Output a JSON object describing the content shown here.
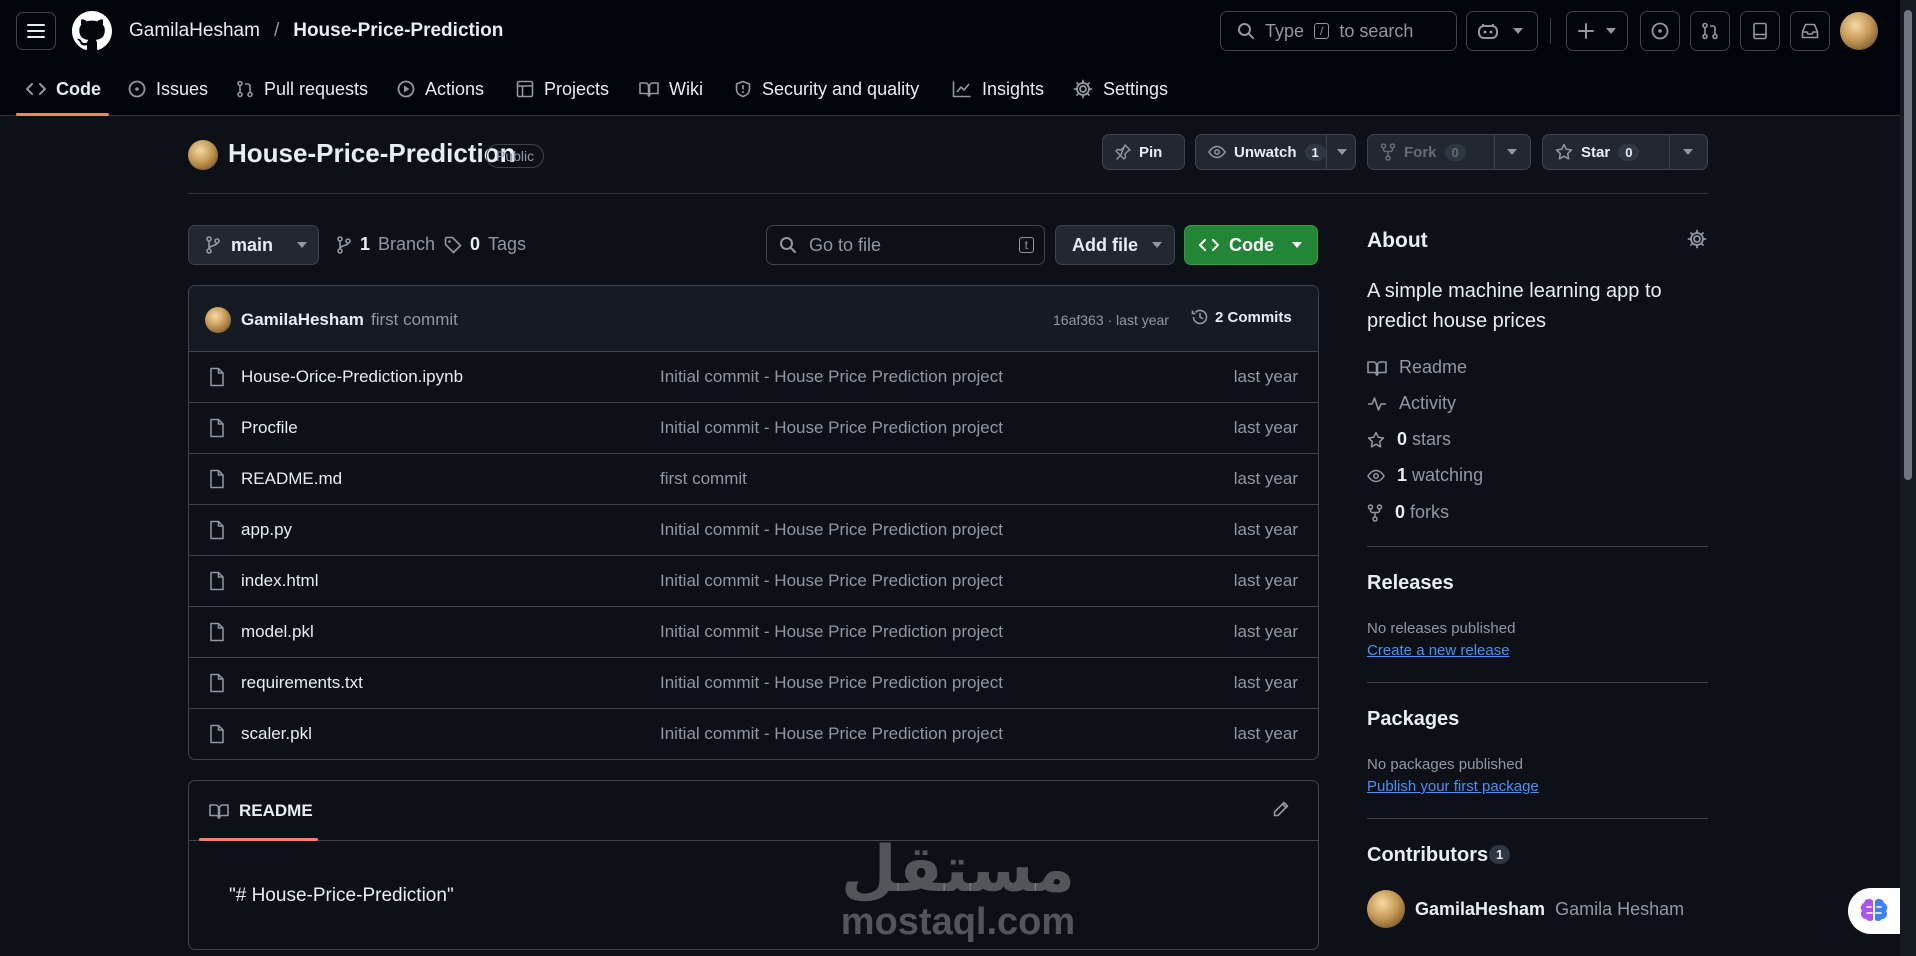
{
  "nav": {
    "owner": "GamilaHesham",
    "separator": "/",
    "repo": "House-Price-Prediction",
    "search_prefix": "Type",
    "search_key": "/",
    "search_suffix": "to search"
  },
  "tabs": [
    {
      "label": "Code",
      "icon": "code-icon"
    },
    {
      "label": "Issues",
      "icon": "issue-icon"
    },
    {
      "label": "Pull requests",
      "icon": "pull-request-icon"
    },
    {
      "label": "Actions",
      "icon": "play-icon"
    },
    {
      "label": "Projects",
      "icon": "table-icon"
    },
    {
      "label": "Wiki",
      "icon": "book-icon"
    },
    {
      "label": "Security and quality",
      "icon": "shield-icon"
    },
    {
      "label": "Insights",
      "icon": "graph-icon"
    },
    {
      "label": "Settings",
      "icon": "gear-icon"
    }
  ],
  "repo_head": {
    "title": "House-Price-Prediction",
    "visibility": "Public",
    "pin_label": "Pin",
    "watch_label": "Unwatch",
    "watch_count": "1",
    "fork_label": "Fork",
    "fork_count": "0",
    "star_label": "Star",
    "star_count": "0"
  },
  "file_nav": {
    "branch": "main",
    "branch_count": "1",
    "branch_label": "Branch",
    "tag_count": "0",
    "tag_label": "Tags",
    "goto_placeholder": "Go to file",
    "goto_key": "t",
    "add_file_label": "Add file",
    "code_label": "Code"
  },
  "latest_commit": {
    "author": "GamilaHesham",
    "message": "first commit",
    "sha_time": "16af363 · last year",
    "commits_label": "2 Commits"
  },
  "files": [
    {
      "name": "House-Orice-Prediction.ipynb",
      "message": "Initial commit - House Price Prediction project",
      "date": "last year"
    },
    {
      "name": "Procfile",
      "message": "Initial commit - House Price Prediction project",
      "date": "last year"
    },
    {
      "name": "README.md",
      "message": "first commit",
      "date": "last year"
    },
    {
      "name": "app.py",
      "message": "Initial commit - House Price Prediction project",
      "date": "last year"
    },
    {
      "name": "index.html",
      "message": "Initial commit - House Price Prediction project",
      "date": "last year"
    },
    {
      "name": "model.pkl",
      "message": "Initial commit - House Price Prediction project",
      "date": "last year"
    },
    {
      "name": "requirements.txt",
      "message": "Initial commit - House Price Prediction project",
      "date": "last year"
    },
    {
      "name": "scaler.pkl",
      "message": "Initial commit - House Price Prediction project",
      "date": "last year"
    }
  ],
  "readme": {
    "tab_label": "README",
    "content": "\"# House-Price-Prediction\""
  },
  "about": {
    "title": "About",
    "description": "A simple machine learning app to predict house prices",
    "readme_label": "Readme",
    "activity_label": "Activity",
    "stars_count": "0",
    "stars_label": "stars",
    "watching_count": "1",
    "watching_label": "watching",
    "forks_count": "0",
    "forks_label": "forks"
  },
  "releases": {
    "title": "Releases",
    "empty": "No releases published",
    "link": "Create a new release"
  },
  "packages": {
    "title": "Packages",
    "empty": "No packages published",
    "link": "Publish your first package"
  },
  "contributors": {
    "title": "Contributors",
    "count": "1",
    "user": "GamilaHesham",
    "full_name": "Gamila Hesham"
  },
  "watermark": {
    "arabic": "مستقل",
    "latin": "mostaql.com"
  },
  "colors": {
    "background": "#0d1117",
    "header_bg": "#010409",
    "accent_underline": "#f78166",
    "primary_button": "#238636",
    "link": "#4493f8"
  }
}
